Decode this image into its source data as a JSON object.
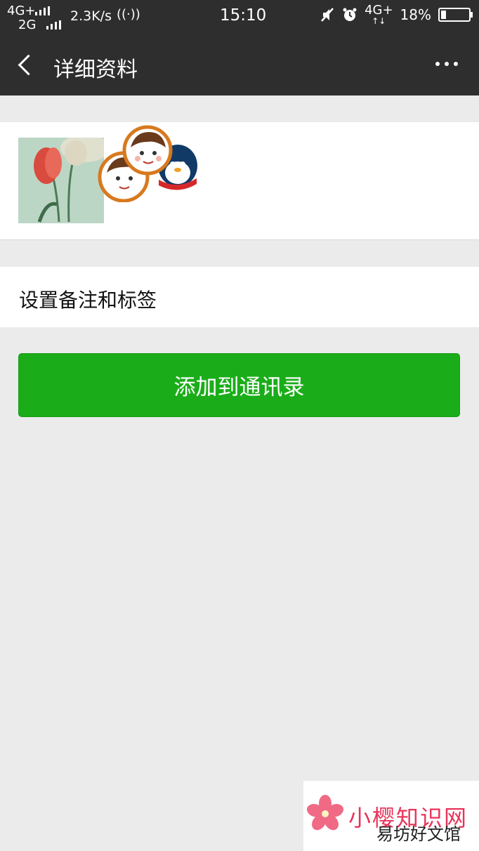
{
  "status_bar": {
    "sim1": "4G+",
    "sim2": "2G",
    "speed": "2.3K/s",
    "hotspot": "((·))",
    "time": "15:10",
    "net": "4G+",
    "net_arrows": "↑↓",
    "battery": "18%",
    "battery_level": 0.18
  },
  "title_bar": {
    "title": "详细资料"
  },
  "remark_row": {
    "label": "设置备注和标签"
  },
  "add_button": {
    "label": "添加到通讯录"
  },
  "watermark": {
    "brand": "小樱知识网",
    "sub": "易坊好文馆"
  },
  "colors": {
    "bar_bg": "#2e2e2e",
    "page_bg": "#ebebeb",
    "primary_green": "#1aad19",
    "watermark_pink": "#e8345b"
  },
  "icons": [
    "back-arrow-icon",
    "more-dots-icon",
    "mute-icon",
    "alarm-icon",
    "battery-icon",
    "hotspot-icon",
    "signal-icon"
  ]
}
